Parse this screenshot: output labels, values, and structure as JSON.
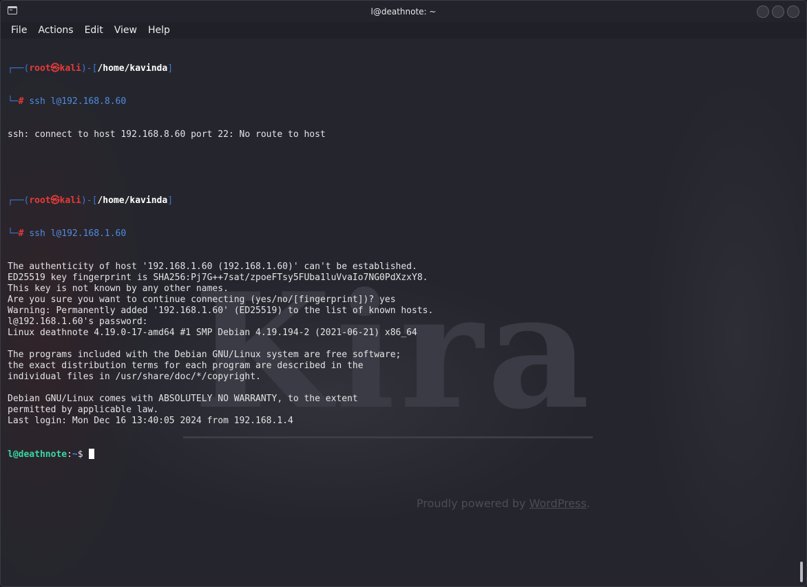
{
  "window": {
    "title": "l@deathnote: ~"
  },
  "menu": [
    "File",
    "Actions",
    "Edit",
    "View",
    "Help"
  ],
  "background": {
    "heading": "Kira",
    "footer_prefix": "Proudly powered by ",
    "footer_link": "WordPress",
    "footer_suffix": "."
  },
  "terminal": {
    "prompts": [
      {
        "user": "root",
        "host": "kali",
        "path": "/home/kavinda",
        "command": "ssh l@192.168.8.60"
      },
      {
        "user": "root",
        "host": "kali",
        "path": "/home/kavinda",
        "command": "ssh l@192.168.1.60"
      }
    ],
    "output1": [
      "ssh: connect to host 192.168.8.60 port 22: No route to host"
    ],
    "output2": [
      "The authenticity of host '192.168.1.60 (192.168.1.60)' can't be established.",
      "ED25519 key fingerprint is SHA256:Pj7G++7sat/zpoeFTsy5FUba1luVvaIo7NG0PdXzxY8.",
      "This key is not known by any other names.",
      "Are you sure you want to continue connecting (yes/no/[fingerprint])? yes",
      "Warning: Permanently added '192.168.1.60' (ED25519) to the list of known hosts.",
      "l@192.168.1.60's password:",
      "Linux deathnote 4.19.0-17-amd64 #1 SMP Debian 4.19.194-2 (2021-06-21) x86_64",
      "",
      "The programs included with the Debian GNU/Linux system are free software;",
      "the exact distribution terms for each program are described in the",
      "individual files in /usr/share/doc/*/copyright.",
      "",
      "Debian GNU/Linux comes with ABSOLUTELY NO WARRANTY, to the extent",
      "permitted by applicable law.",
      "Last login: Mon Dec 16 13:40:05 2024 from 192.168.1.4"
    ],
    "final_prompt": {
      "userhost": "l@deathnote",
      "path": "~",
      "symbol": "$"
    }
  }
}
